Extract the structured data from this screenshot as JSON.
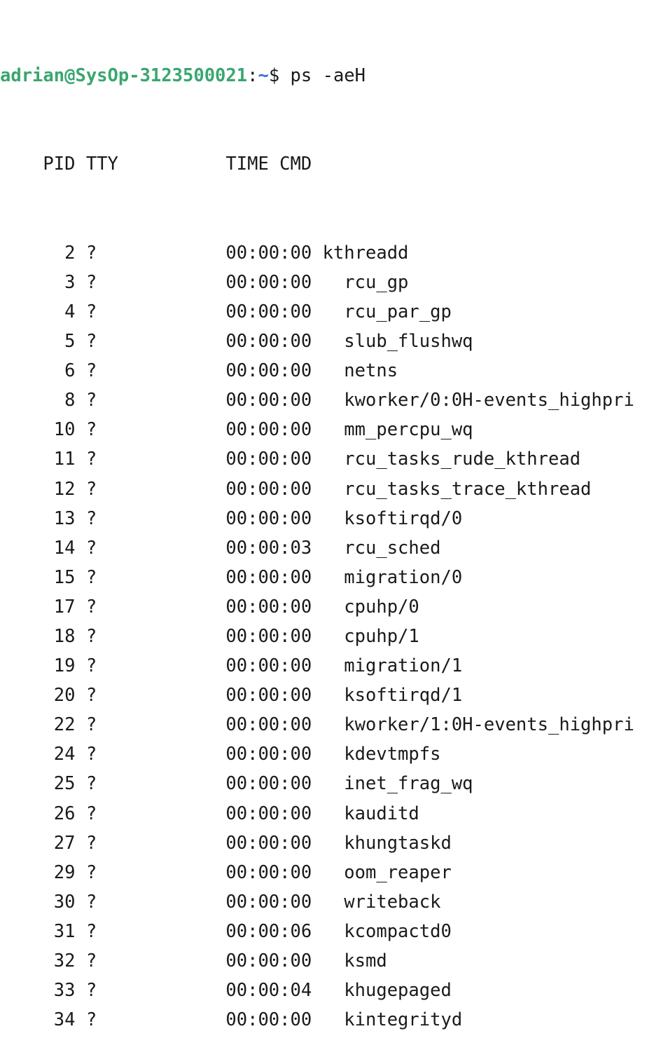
{
  "prompt": {
    "user_host": "adrian@SysOp-3123500021",
    "separator": ":",
    "path": "~",
    "symbol": "$ ",
    "command": "ps -aeH"
  },
  "header": "    PID TTY          TIME CMD",
  "rows": [
    {
      "pid": "2",
      "tty": "?",
      "time": "00:00:00",
      "depth": 0,
      "cmd": "kthreadd"
    },
    {
      "pid": "3",
      "tty": "?",
      "time": "00:00:00",
      "depth": 1,
      "cmd": "rcu_gp"
    },
    {
      "pid": "4",
      "tty": "?",
      "time": "00:00:00",
      "depth": 1,
      "cmd": "rcu_par_gp"
    },
    {
      "pid": "5",
      "tty": "?",
      "time": "00:00:00",
      "depth": 1,
      "cmd": "slub_flushwq"
    },
    {
      "pid": "6",
      "tty": "?",
      "time": "00:00:00",
      "depth": 1,
      "cmd": "netns"
    },
    {
      "pid": "8",
      "tty": "?",
      "time": "00:00:00",
      "depth": 1,
      "cmd": "kworker/0:0H-events_highpri"
    },
    {
      "pid": "10",
      "tty": "?",
      "time": "00:00:00",
      "depth": 1,
      "cmd": "mm_percpu_wq"
    },
    {
      "pid": "11",
      "tty": "?",
      "time": "00:00:00",
      "depth": 1,
      "cmd": "rcu_tasks_rude_kthread"
    },
    {
      "pid": "12",
      "tty": "?",
      "time": "00:00:00",
      "depth": 1,
      "cmd": "rcu_tasks_trace_kthread"
    },
    {
      "pid": "13",
      "tty": "?",
      "time": "00:00:00",
      "depth": 1,
      "cmd": "ksoftirqd/0"
    },
    {
      "pid": "14",
      "tty": "?",
      "time": "00:00:03",
      "depth": 1,
      "cmd": "rcu_sched"
    },
    {
      "pid": "15",
      "tty": "?",
      "time": "00:00:00",
      "depth": 1,
      "cmd": "migration/0"
    },
    {
      "pid": "17",
      "tty": "?",
      "time": "00:00:00",
      "depth": 1,
      "cmd": "cpuhp/0"
    },
    {
      "pid": "18",
      "tty": "?",
      "time": "00:00:00",
      "depth": 1,
      "cmd": "cpuhp/1"
    },
    {
      "pid": "19",
      "tty": "?",
      "time": "00:00:00",
      "depth": 1,
      "cmd": "migration/1"
    },
    {
      "pid": "20",
      "tty": "?",
      "time": "00:00:00",
      "depth": 1,
      "cmd": "ksoftirqd/1"
    },
    {
      "pid": "22",
      "tty": "?",
      "time": "00:00:00",
      "depth": 1,
      "cmd": "kworker/1:0H-events_highpri"
    },
    {
      "pid": "24",
      "tty": "?",
      "time": "00:00:00",
      "depth": 1,
      "cmd": "kdevtmpfs"
    },
    {
      "pid": "25",
      "tty": "?",
      "time": "00:00:00",
      "depth": 1,
      "cmd": "inet_frag_wq"
    },
    {
      "pid": "26",
      "tty": "?",
      "time": "00:00:00",
      "depth": 1,
      "cmd": "kauditd"
    },
    {
      "pid": "27",
      "tty": "?",
      "time": "00:00:00",
      "depth": 1,
      "cmd": "khungtaskd"
    },
    {
      "pid": "29",
      "tty": "?",
      "time": "00:00:00",
      "depth": 1,
      "cmd": "oom_reaper"
    },
    {
      "pid": "30",
      "tty": "?",
      "time": "00:00:00",
      "depth": 1,
      "cmd": "writeback"
    },
    {
      "pid": "31",
      "tty": "?",
      "time": "00:00:06",
      "depth": 1,
      "cmd": "kcompactd0"
    },
    {
      "pid": "32",
      "tty": "?",
      "time": "00:00:00",
      "depth": 1,
      "cmd": "ksmd"
    },
    {
      "pid": "33",
      "tty": "?",
      "time": "00:00:04",
      "depth": 1,
      "cmd": "khugepaged"
    },
    {
      "pid": "34",
      "tty": "?",
      "time": "00:00:00",
      "depth": 1,
      "cmd": "kintegrityd"
    }
  ],
  "colors": {
    "background": "#ffffff",
    "text": "#1a1a1a",
    "prompt_user": "#3aa66f",
    "prompt_path": "#3b6fd6"
  }
}
